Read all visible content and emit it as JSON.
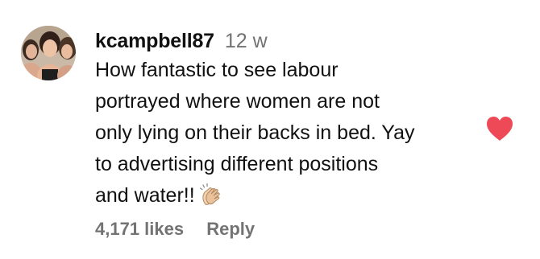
{
  "comment": {
    "username": "kcampbell87",
    "timestamp": "12 w",
    "text_lines": [
      "How fantastic to see labour",
      "portrayed where women are not",
      "only lying on their backs in bed. Yay",
      "to advertising different positions",
      "and water!!"
    ],
    "emoji": "clapping-hands-icon",
    "likes": "4,171 likes",
    "reply_label": "Reply",
    "liked": true
  },
  "colors": {
    "text": "#111111",
    "secondary_text": "#737373",
    "heart": "#ed4956"
  }
}
